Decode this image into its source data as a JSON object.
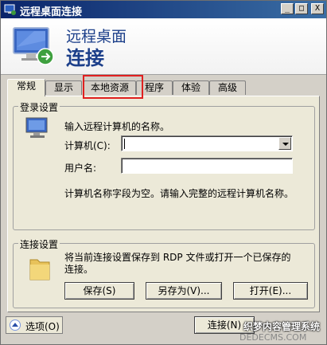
{
  "window": {
    "title": "远程桌面连接",
    "buttons": {
      "minimize": "_",
      "maximize": "□",
      "close": "X"
    }
  },
  "banner": {
    "line1": "远程桌面",
    "line2": "连接"
  },
  "tabs": [
    {
      "label": "常规"
    },
    {
      "label": "显示"
    },
    {
      "label": "本地资源"
    },
    {
      "label": "程序"
    },
    {
      "label": "体验"
    },
    {
      "label": "高级"
    }
  ],
  "login": {
    "group_label": "登录设置",
    "instruction": "输入远程计算机的名称。",
    "computer_label": "计算机(C):",
    "computer_value": "",
    "username_label": "用户名:",
    "username_value": "",
    "hint": "计算机名称字段为空。请输入完整的远程计算机名称。"
  },
  "connection": {
    "group_label": "连接设置",
    "description": "将当前连接设置保存到 RDP 文件或打开一个已保存的连接。",
    "save_label": "保存(S)",
    "save_as_label": "另存为(V)...",
    "open_label": "打开(E)..."
  },
  "bottom": {
    "options_label": "选项(O)",
    "connect_label": "连接(N)"
  },
  "watermark": {
    "line1": "织梦内容管理系统",
    "line2": "DEDECMS.COM"
  },
  "colors": {
    "title_bar": "#0a246a",
    "banner_text": "#1c3f8a",
    "highlight": "#e02020"
  }
}
